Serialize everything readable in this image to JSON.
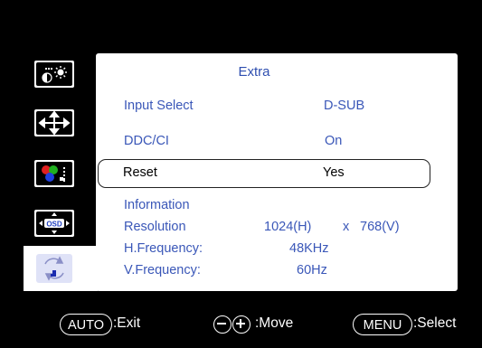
{
  "menu": {
    "title": "Extra",
    "rows": [
      {
        "label": "Input Select",
        "value": "D-SUB"
      },
      {
        "label": "DDC/CI",
        "value": "On"
      },
      {
        "label": "Reset",
        "value": "Yes"
      }
    ],
    "information": {
      "heading": "Information",
      "resolution_label": "Resolution",
      "resolution_h": "1024(H)",
      "resolution_x": "x",
      "resolution_v": "768(V)",
      "hfreq_label": "H.Frequency:",
      "hfreq_value": "48KHz",
      "vfreq_label": "V.Frequency:",
      "vfreq_value": "60Hz"
    }
  },
  "sidebar": {
    "icons": [
      "brightness-contrast-icon",
      "position-move-icon",
      "color-settings-icon",
      "osd-settings-icon",
      "extra-icon"
    ],
    "osd_text": "OSD"
  },
  "footer": {
    "auto_label": "AUTO",
    "auto_action": ":Exit",
    "move_action": ":Move",
    "menu_label": "MENU",
    "menu_action": ":Select"
  },
  "colors": {
    "background": "#000000",
    "panel": "#ffffff",
    "text_blue": "#3a57b8",
    "active_tab": "#dfe2f7"
  }
}
